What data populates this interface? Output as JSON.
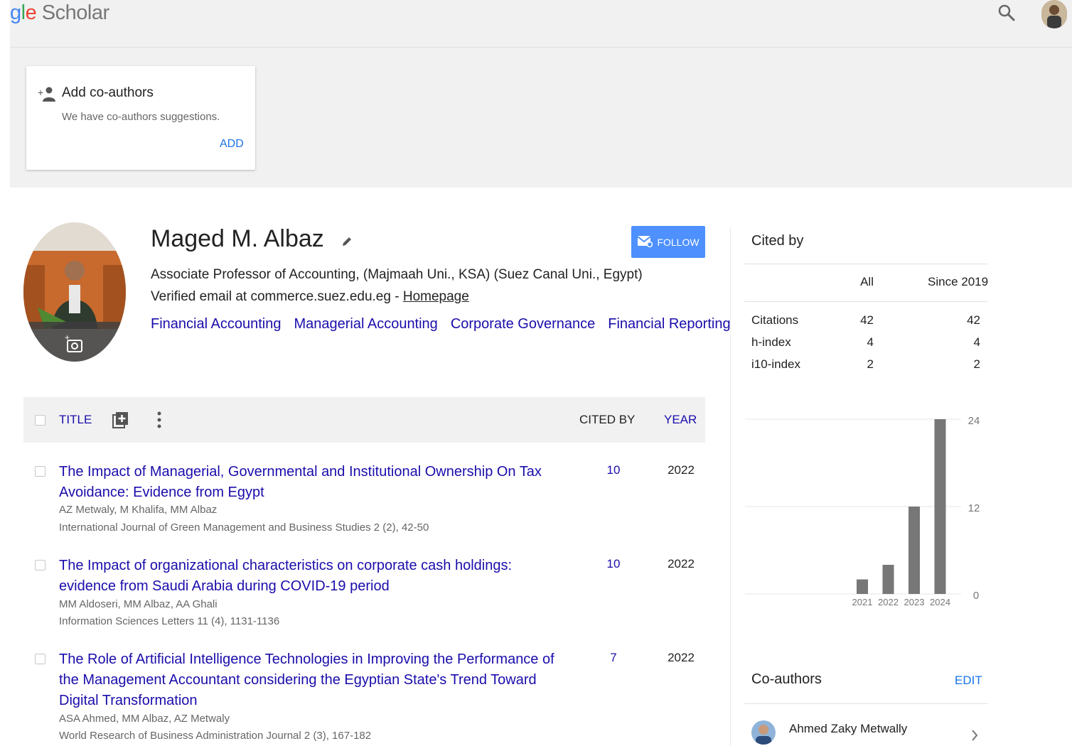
{
  "header": {
    "logo_g": "g",
    "logo_l": "l",
    "logo_e": "e",
    "logo_rest": " Scholar"
  },
  "coauthor_card": {
    "title": "Add co-authors",
    "subtitle": "We have co-authors suggestions.",
    "add_label": "ADD"
  },
  "profile": {
    "name": "Maged M. Albaz",
    "affiliation": "Associate Professor of Accounting, (Majmaah Uni., KSA) (Suez Canal Uni., Egypt)",
    "email_text": "Verified email at commerce.suez.edu.eg - ",
    "homepage_label": "Homepage",
    "interests": [
      "Financial Accounting",
      "Managerial Accounting",
      "Corporate Governance",
      "Financial Reporting"
    ],
    "follow_label": "FOLLOW"
  },
  "table": {
    "title_header": "TITLE",
    "cited_by_header": "CITED BY",
    "year_header": "YEAR",
    "rows": [
      {
        "title": "The Impact of Managerial, Governmental and Institutional Ownership On Tax Avoidance: Evidence from Egypt",
        "authors": "AZ Metwaly, M Khalifa, MM Albaz",
        "venue": "International Journal of Green Management and Business Studies 2 (2), 42-50",
        "cited_by": "10",
        "year": "2022"
      },
      {
        "title": "The Impact of organizational characteristics on corporate cash holdings: evidence from Saudi Arabia during COVID-19 period",
        "authors": "MM Aldoseri, MM Albaz, AA Ghali",
        "venue": "Information Sciences Letters 11 (4), 1131-1136",
        "cited_by": "10",
        "year": "2022"
      },
      {
        "title": "The Role of Artificial Intelligence Technologies in Improving the Performance of the Management Accountant considering the Egyptian State's Trend Toward Digital Transformation",
        "authors": "ASA Ahmed, MM Albaz, AZ Metwaly",
        "venue": "World Research of Business Administration Journal 2 (3), 167-182",
        "cited_by": "7",
        "year": "2022"
      }
    ]
  },
  "cited_by": {
    "title": "Cited by",
    "col_all": "All",
    "col_since": "Since 2019",
    "rows": [
      {
        "label": "Citations",
        "all": "42",
        "since": "42"
      },
      {
        "label": "h-index",
        "all": "4",
        "since": "4"
      },
      {
        "label": "i10-index",
        "all": "2",
        "since": "2"
      }
    ]
  },
  "chart_data": {
    "type": "bar",
    "categories": [
      "2021",
      "2022",
      "2023",
      "2024"
    ],
    "values": [
      2,
      4,
      12,
      24
    ],
    "ylim": [
      0,
      24
    ],
    "yticks": [
      "24",
      "12",
      "0"
    ],
    "bar_color": "#777777",
    "grid": true
  },
  "coauthors": {
    "title": "Co-authors",
    "edit_label": "EDIT",
    "items": [
      {
        "name": "Ahmed Zaky Metwally"
      }
    ]
  }
}
